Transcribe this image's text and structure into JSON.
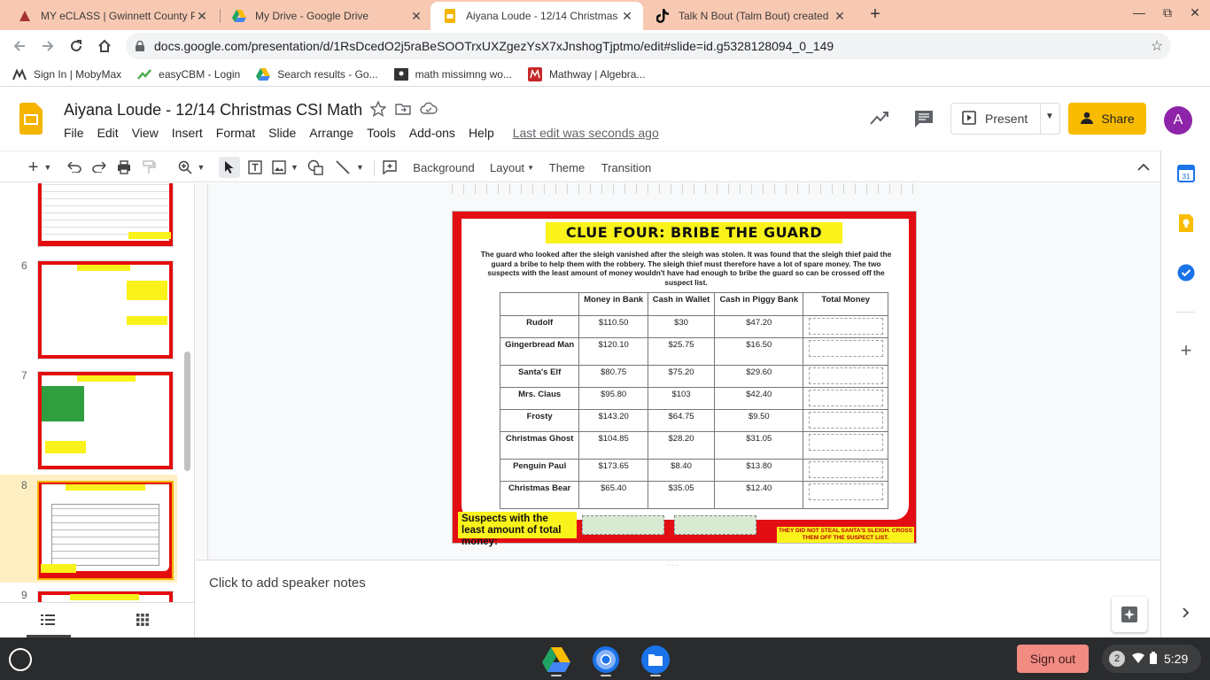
{
  "browser": {
    "tabs": [
      {
        "title": "MY eCLASS | Gwinnett County P",
        "icon": "eclass-icon"
      },
      {
        "title": "My Drive - Google Drive",
        "icon": "google-drive-icon"
      },
      {
        "title": "Aiyana Loude - 12/14 Christmas",
        "icon": "google-slides-icon",
        "active": true
      },
      {
        "title": "Talk N Bout (Talm Bout) created",
        "icon": "tiktok-icon"
      }
    ],
    "url": "docs.google.com/presentation/d/1RsDcedO2j5raBeSOOTrxUXZgezYsX7xJnshogTjptmo/edit#slide=id.g5328128094_0_149",
    "bookmarks": [
      {
        "label": "Sign In | MobyMax",
        "icon": "mobymax-icon"
      },
      {
        "label": "easyCBM - Login",
        "icon": "easycbm-icon"
      },
      {
        "label": "Search results - Go...",
        "icon": "google-drive-icon"
      },
      {
        "label": "math missimng wo...",
        "icon": "classroom-icon"
      },
      {
        "label": "Mathway | Algebra...",
        "icon": "mathway-icon"
      }
    ]
  },
  "app": {
    "title": "Aiyana Loude - 12/14 Christmas CSI Math",
    "menus": [
      "File",
      "Edit",
      "View",
      "Insert",
      "Format",
      "Slide",
      "Arrange",
      "Tools",
      "Add-ons",
      "Help"
    ],
    "last_edit": "Last edit was seconds ago",
    "present_label": "Present",
    "share_label": "Share",
    "avatar_letter": "A"
  },
  "toolbar": {
    "background": "Background",
    "layout": "Layout",
    "theme": "Theme",
    "transition": "Transition"
  },
  "filmstrip": {
    "slides": [
      {
        "num": "6"
      },
      {
        "num": "7"
      },
      {
        "num": "8",
        "current": true
      },
      {
        "num": "9"
      }
    ]
  },
  "slide": {
    "title": "CLUE FOUR: BRIBE THE GUARD",
    "paragraph": "The guard who looked after the sleigh vanished after the sleigh was stolen. It was found that the sleigh thief paid the guard a bribe to help them with the robbery. The sleigh thief must therefore have a lot of spare money. The two suspects with the least amount of money wouldn't have had enough to bribe the guard so can be crossed off the suspect list.",
    "headers": [
      "",
      "Money in Bank",
      "Cash in Wallet",
      "Cash in Piggy Bank",
      "Total Money"
    ],
    "rows": [
      {
        "name": "Rudolf",
        "bank": "$110.50",
        "wallet": "$30",
        "piggy": "$47.20"
      },
      {
        "name": "Gingerbread Man",
        "bank": "$120.10",
        "wallet": "$25.75",
        "piggy": "$16.50"
      },
      {
        "name": "Santa's Elf",
        "bank": "$80.75",
        "wallet": "$75.20",
        "piggy": "$29.60"
      },
      {
        "name": "Mrs. Claus",
        "bank": "$95.80",
        "wallet": "$103",
        "piggy": "$42.40"
      },
      {
        "name": "Frosty",
        "bank": "$143.20",
        "wallet": "$64.75",
        "piggy": "$9.50"
      },
      {
        "name": "Christmas Ghost",
        "bank": "$104.85",
        "wallet": "$28.20",
        "piggy": "$31.05"
      },
      {
        "name": "Penguin Paul",
        "bank": "$173.65",
        "wallet": "$8.40",
        "piggy": "$13.80"
      },
      {
        "name": "Christmas Bear",
        "bank": "$65.40",
        "wallet": "$35.05",
        "piggy": "$12.40"
      }
    ],
    "suspects_label": "Suspects with the least amount of total money:",
    "warning": "THEY DID NOT STEAL SANTA'S SLEIGH. CROSS THEM OFF THE SUSPECT LIST."
  },
  "notes": {
    "placeholder": "Click to add speaker notes"
  },
  "taskbar": {
    "signout": "Sign out",
    "notif_count": "2",
    "time": "5:29"
  }
}
